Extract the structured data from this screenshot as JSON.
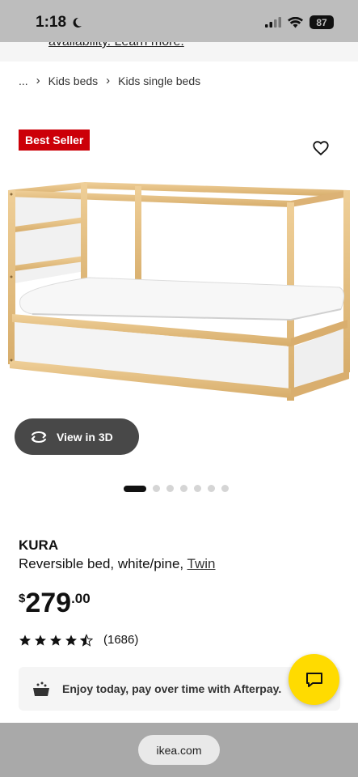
{
  "status_bar": {
    "time": "1:18",
    "battery": "87"
  },
  "banner": {
    "text": "availability. Learn more."
  },
  "breadcrumb": {
    "ellipsis": "...",
    "items": [
      "Kids beds",
      "Kids single beds"
    ]
  },
  "product": {
    "badge": "Best Seller",
    "view_3d_label": "View in 3D",
    "image_count": 7,
    "active_image": 0,
    "name": "KURA",
    "description": "Reversible bed, white/pine, ",
    "size_link": "Twin",
    "price": {
      "currency": "$",
      "whole": "279",
      "cents": ".00"
    },
    "rating": {
      "value": 4.5,
      "count": "(1686)"
    }
  },
  "afterpay": {
    "text": "Enjoy today, pay over time with Afterpay."
  },
  "browser": {
    "url": "ikea.com"
  },
  "colors": {
    "badge_red": "#cc0008",
    "chat_yellow": "#ffdb00",
    "view3d_bg": "#484848"
  },
  "icons": [
    "moon-icon",
    "signal-icon",
    "wifi-icon",
    "battery-icon",
    "heart-icon",
    "rotate-3d-icon",
    "star-icon",
    "afterpay-icon",
    "chat-icon"
  ]
}
